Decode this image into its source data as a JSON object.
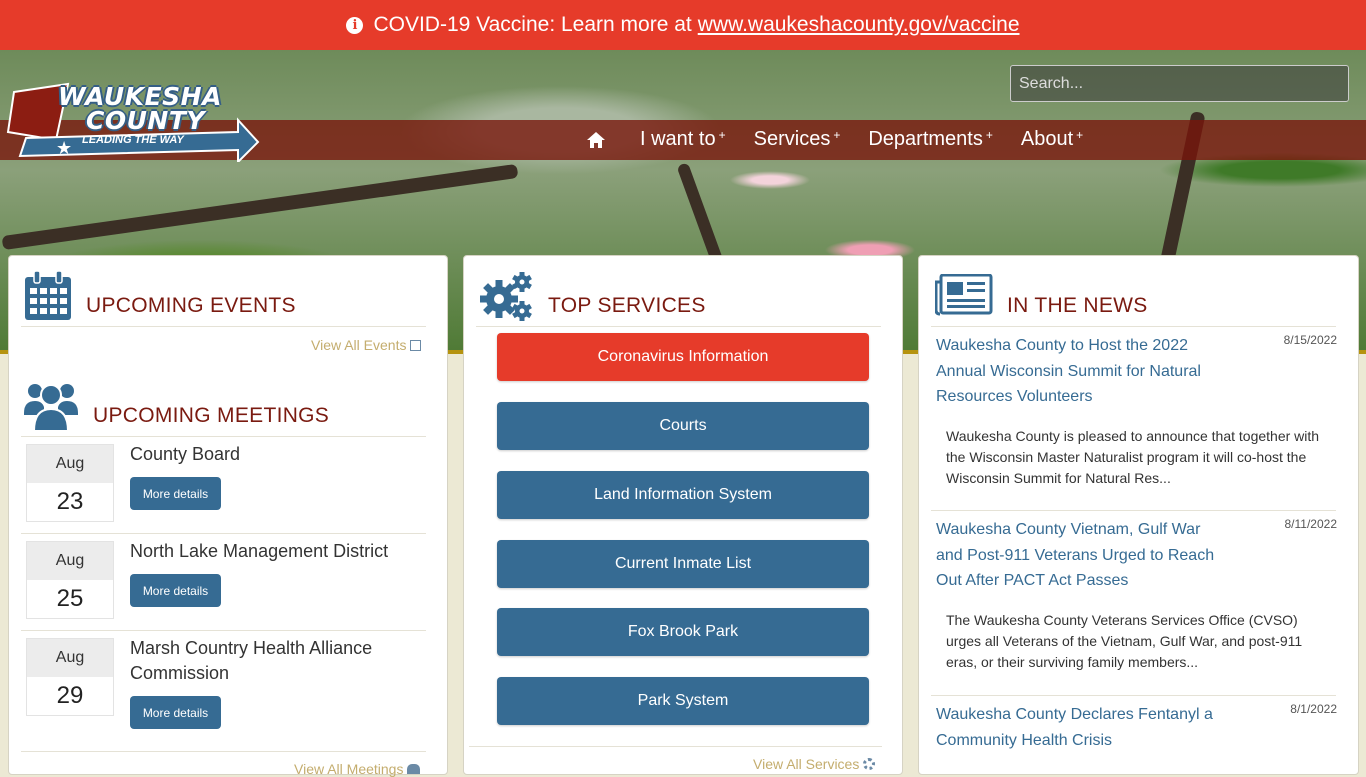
{
  "alert": {
    "prefix": "COVID-19 Vaccine: Learn more at",
    "link": "www.waukeshacounty.gov/vaccine"
  },
  "logo": {
    "line1": "WAUKESHA",
    "line2": "COUNTY",
    "tagline": "LEADING THE WAY"
  },
  "search": {
    "placeholder": "Search..."
  },
  "nav": {
    "items": [
      {
        "label": "I want to",
        "plus": "+"
      },
      {
        "label": "Services",
        "plus": "+"
      },
      {
        "label": "Departments",
        "plus": "+"
      },
      {
        "label": "About",
        "plus": "+"
      }
    ]
  },
  "events": {
    "title": "UPCOMING EVENTS",
    "view_all": "View All Events"
  },
  "meetings": {
    "title": "UPCOMING MEETINGS",
    "view_all": "View All Meetings",
    "more_label": "More details",
    "items": [
      {
        "month": "Aug",
        "day": "23",
        "title": "County Board"
      },
      {
        "month": "Aug",
        "day": "25",
        "title": "North Lake Management District"
      },
      {
        "month": "Aug",
        "day": "29",
        "title": "Marsh Country Health Alliance Commission"
      }
    ]
  },
  "services": {
    "title": "TOP SERVICES",
    "view_all": "View All Services",
    "items": [
      "Coronavirus Information",
      "Courts",
      "Land Information System",
      "Current Inmate List",
      "Fox Brook Park",
      "Park System"
    ]
  },
  "news": {
    "title": "IN THE NEWS",
    "items": [
      {
        "title": "Waukesha County to Host the 2022 Annual Wisconsin Summit for Natural Resources Volunteers",
        "date": "8/15/2022",
        "summary": "Waukesha County is pleased to announce that together with the Wisconsin Master Naturalist program it will co-host the Wisconsin Summit for Natural Res..."
      },
      {
        "title": "Waukesha County Vietnam, Gulf War and Post-911 Veterans Urged to Reach Out After PACT Act Passes",
        "date": "8/11/2022",
        "summary": "The Waukesha County Veterans Services Office (CVSO) urges all Veterans of the Vietnam, Gulf War, and post-911 eras, or their surviving family members..."
      },
      {
        "title": "Waukesha County Declares Fentanyl a Community Health Crisis",
        "date": "8/1/2022",
        "summary": ""
      }
    ]
  },
  "colors": {
    "alert": "#e63b2a",
    "primary_button": "#366b93",
    "heading": "#7a1a10",
    "link": "#366b93",
    "view_all": "#c4ad6e"
  }
}
